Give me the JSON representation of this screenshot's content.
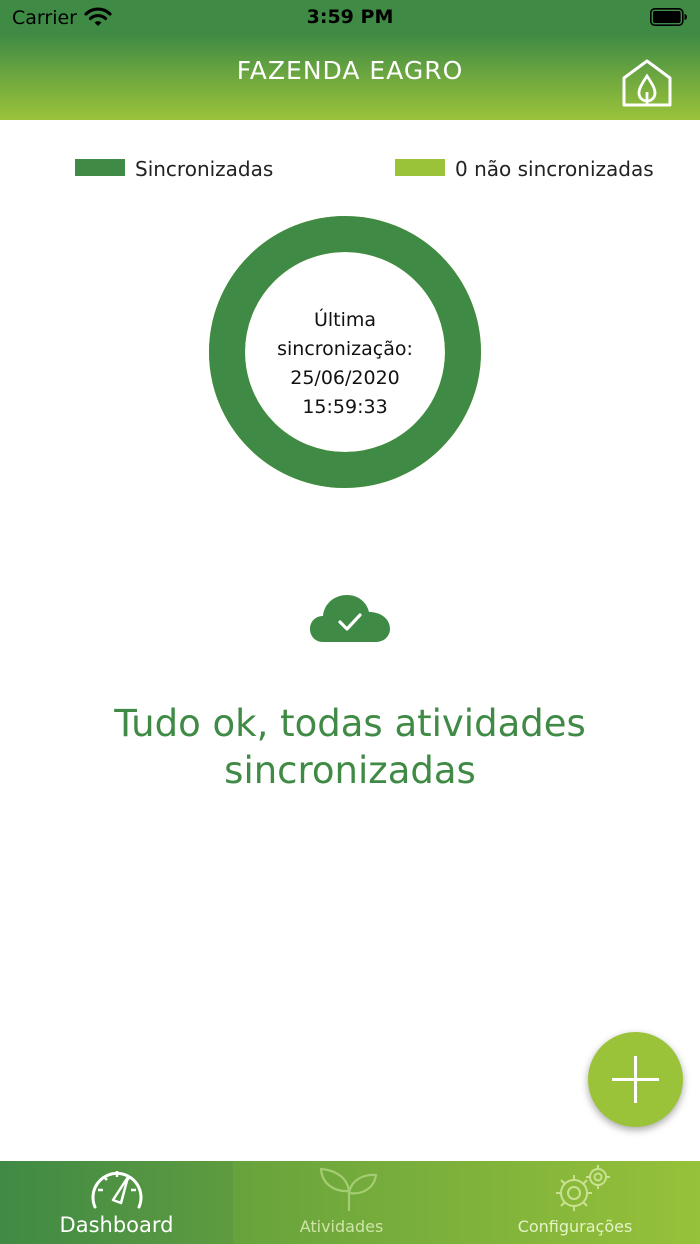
{
  "status_bar": {
    "carrier": "Carrier",
    "time": "3:59 PM"
  },
  "header": {
    "title": "FAZENDA EAGRO"
  },
  "legend": [
    {
      "label": "Sincronizadas",
      "color": "#3f8a45"
    },
    {
      "label": "0 não sincronizadas",
      "color": "#9bc33a"
    }
  ],
  "donut": {
    "synced_fraction": 1.0,
    "center_lines": [
      "Última",
      "sincronização:",
      "25/06/2020",
      "15:59:33"
    ]
  },
  "status_message": {
    "line1": "Tudo ok, todas atividades",
    "line2": "sincronizadas"
  },
  "colors": {
    "primary": "#3f8a45",
    "accent": "#9bc33a"
  },
  "tabs": [
    {
      "label": "Dashboard",
      "icon": "speedometer-icon",
      "active": true
    },
    {
      "label": "Atividades",
      "icon": "sprout-icon",
      "active": false
    },
    {
      "label": "Configurações",
      "icon": "gears-icon",
      "active": false
    }
  ]
}
